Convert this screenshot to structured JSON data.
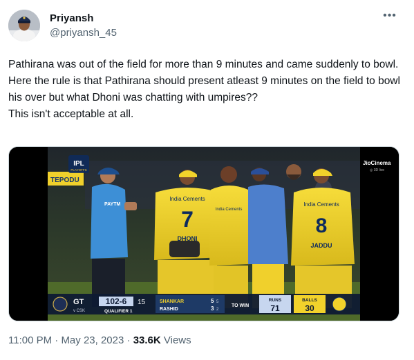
{
  "author": {
    "display_name": "Priyansh",
    "handle": "@priyansh_45"
  },
  "more_glyph": "•••",
  "tweet": {
    "text": "Pathirana was out of the field for more than 9 minutes and came suddenly to bowl. Here the rule is that Pathirana should present atleast 9 minutes on the field to bowl his over but what Dhoni was chatting with umpires??\nThis isn't acceptable at all."
  },
  "media": {
    "broadcaster": "JioCinema",
    "broadcaster_sub": "◎ 3D live",
    "tournament": "IPL",
    "tournament_sub": "PLAYOFFS",
    "ad_board_left": "TEPODU",
    "scorebar": {
      "batting_team": "GT",
      "vs": "v CSK",
      "score": "102-6",
      "overs": "15",
      "match": "QUALIFIER 1",
      "batter1_name": "SHANKAR",
      "batter1_runs": "5",
      "batter1_balls": "5",
      "batter2_name": "RASHID",
      "batter2_runs": "3",
      "batter2_balls": "2",
      "to_win": "TO WIN",
      "runs_label": "RUNS",
      "runs_value": "71",
      "balls_label": "BALLS",
      "balls_value": "30"
    },
    "jerseys": {
      "left_text": "India Cements",
      "left_number": "7",
      "left_name": "DHONI",
      "right_text": "India Cements",
      "right_number": "8",
      "right_name": "JADDU",
      "middle_text": "India Cements"
    },
    "umpire_logo": "PAYTM"
  },
  "meta": {
    "time": "11:00 PM",
    "separator": "·",
    "date": "May 23, 2023",
    "views_count": "33.6K",
    "views_label": "Views"
  },
  "colors": {
    "text_primary": "#0f1419",
    "text_secondary": "#536471",
    "csk_yellow": "#f2d22b",
    "umpire_blue": "#3d8fd6"
  }
}
